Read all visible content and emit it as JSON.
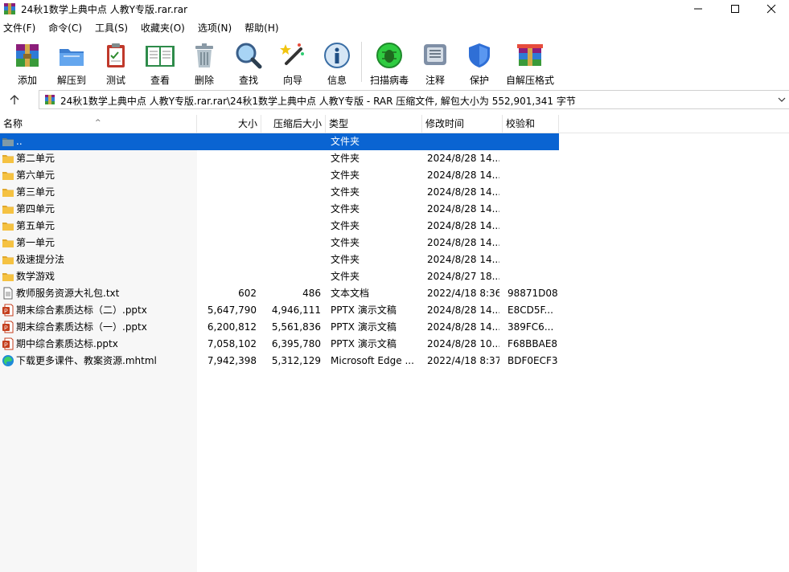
{
  "window": {
    "title": "24秋1数学上典中点 人教Y专版.rar.rar"
  },
  "menu": [
    "文件(F)",
    "命令(C)",
    "工具(S)",
    "收藏夹(O)",
    "选项(N)",
    "帮助(H)"
  ],
  "toolbar": [
    {
      "label": "添加",
      "icon": "add-archive-icon"
    },
    {
      "label": "解压到",
      "icon": "extract-folder-icon"
    },
    {
      "label": "测试",
      "icon": "test-clipboard-icon"
    },
    {
      "label": "查看",
      "icon": "view-book-icon"
    },
    {
      "label": "删除",
      "icon": "trash-icon"
    },
    {
      "label": "查找",
      "icon": "magnifier-icon"
    },
    {
      "label": "向导",
      "icon": "wizard-wand-icon"
    },
    {
      "label": "信息",
      "icon": "info-icon"
    },
    {
      "label": "扫描病毒",
      "icon": "virus-scan-icon"
    },
    {
      "label": "注释",
      "icon": "comment-icon"
    },
    {
      "label": "保护",
      "icon": "shield-icon"
    },
    {
      "label": "自解压格式",
      "icon": "sfx-archive-icon"
    }
  ],
  "address": {
    "path": "24秋1数学上典中点 人教Y专版.rar.rar\\24秋1数学上典中点 人教Y专版 - RAR 压缩文件, 解包大小为 552,901,341 字节"
  },
  "columns": {
    "name": "名称",
    "size": "大小",
    "packed": "压缩后大小",
    "type": "类型",
    "modified": "修改时间",
    "crc": "校验和"
  },
  "files": [
    {
      "name": "..",
      "size": "",
      "packed": "",
      "type": "文件夹",
      "modified": "",
      "crc": "",
      "icon": "parent-folder-icon",
      "selected": true
    },
    {
      "name": "第二单元",
      "size": "",
      "packed": "",
      "type": "文件夹",
      "modified": "2024/8/28 14...",
      "crc": "",
      "icon": "folder-icon"
    },
    {
      "name": "第六单元",
      "size": "",
      "packed": "",
      "type": "文件夹",
      "modified": "2024/8/28 14...",
      "crc": "",
      "icon": "folder-icon"
    },
    {
      "name": "第三单元",
      "size": "",
      "packed": "",
      "type": "文件夹",
      "modified": "2024/8/28 14...",
      "crc": "",
      "icon": "folder-icon"
    },
    {
      "name": "第四单元",
      "size": "",
      "packed": "",
      "type": "文件夹",
      "modified": "2024/8/28 14...",
      "crc": "",
      "icon": "folder-icon"
    },
    {
      "name": "第五单元",
      "size": "",
      "packed": "",
      "type": "文件夹",
      "modified": "2024/8/28 14...",
      "crc": "",
      "icon": "folder-icon"
    },
    {
      "name": "第一单元",
      "size": "",
      "packed": "",
      "type": "文件夹",
      "modified": "2024/8/28 14...",
      "crc": "",
      "icon": "folder-icon"
    },
    {
      "name": "极速提分法",
      "size": "",
      "packed": "",
      "type": "文件夹",
      "modified": "2024/8/28 14...",
      "crc": "",
      "icon": "folder-icon"
    },
    {
      "name": "数学游戏",
      "size": "",
      "packed": "",
      "type": "文件夹",
      "modified": "2024/8/27 18...",
      "crc": "",
      "icon": "folder-icon"
    },
    {
      "name": "教师服务资源大礼包.txt",
      "size": "602",
      "packed": "486",
      "type": "文本文档",
      "modified": "2022/4/18 8:36",
      "crc": "98871D08",
      "icon": "text-file-icon"
    },
    {
      "name": "期末综合素质达标（二）.pptx",
      "size": "5,647,790",
      "packed": "4,946,111",
      "type": "PPTX 演示文稿",
      "modified": "2024/8/28 14...",
      "crc": "E8CD5F...",
      "icon": "pptx-file-icon"
    },
    {
      "name": "期末综合素质达标（一）.pptx",
      "size": "6,200,812",
      "packed": "5,561,836",
      "type": "PPTX 演示文稿",
      "modified": "2024/8/28 14...",
      "crc": "389FC6...",
      "icon": "pptx-file-icon"
    },
    {
      "name": "期中综合素质达标.pptx",
      "size": "7,058,102",
      "packed": "6,395,780",
      "type": "PPTX 演示文稿",
      "modified": "2024/8/28 10...",
      "crc": "F68BBAE8",
      "icon": "pptx-file-icon"
    },
    {
      "name": "下载更多课件、教案资源.mhtml",
      "size": "7,942,398",
      "packed": "5,312,129",
      "type": "Microsoft Edge ...",
      "modified": "2022/4/18 8:37",
      "crc": "BDF0ECF3",
      "icon": "edge-file-icon"
    }
  ],
  "colors": {
    "selection": "#0a64d2",
    "folder": "#f5c242"
  }
}
